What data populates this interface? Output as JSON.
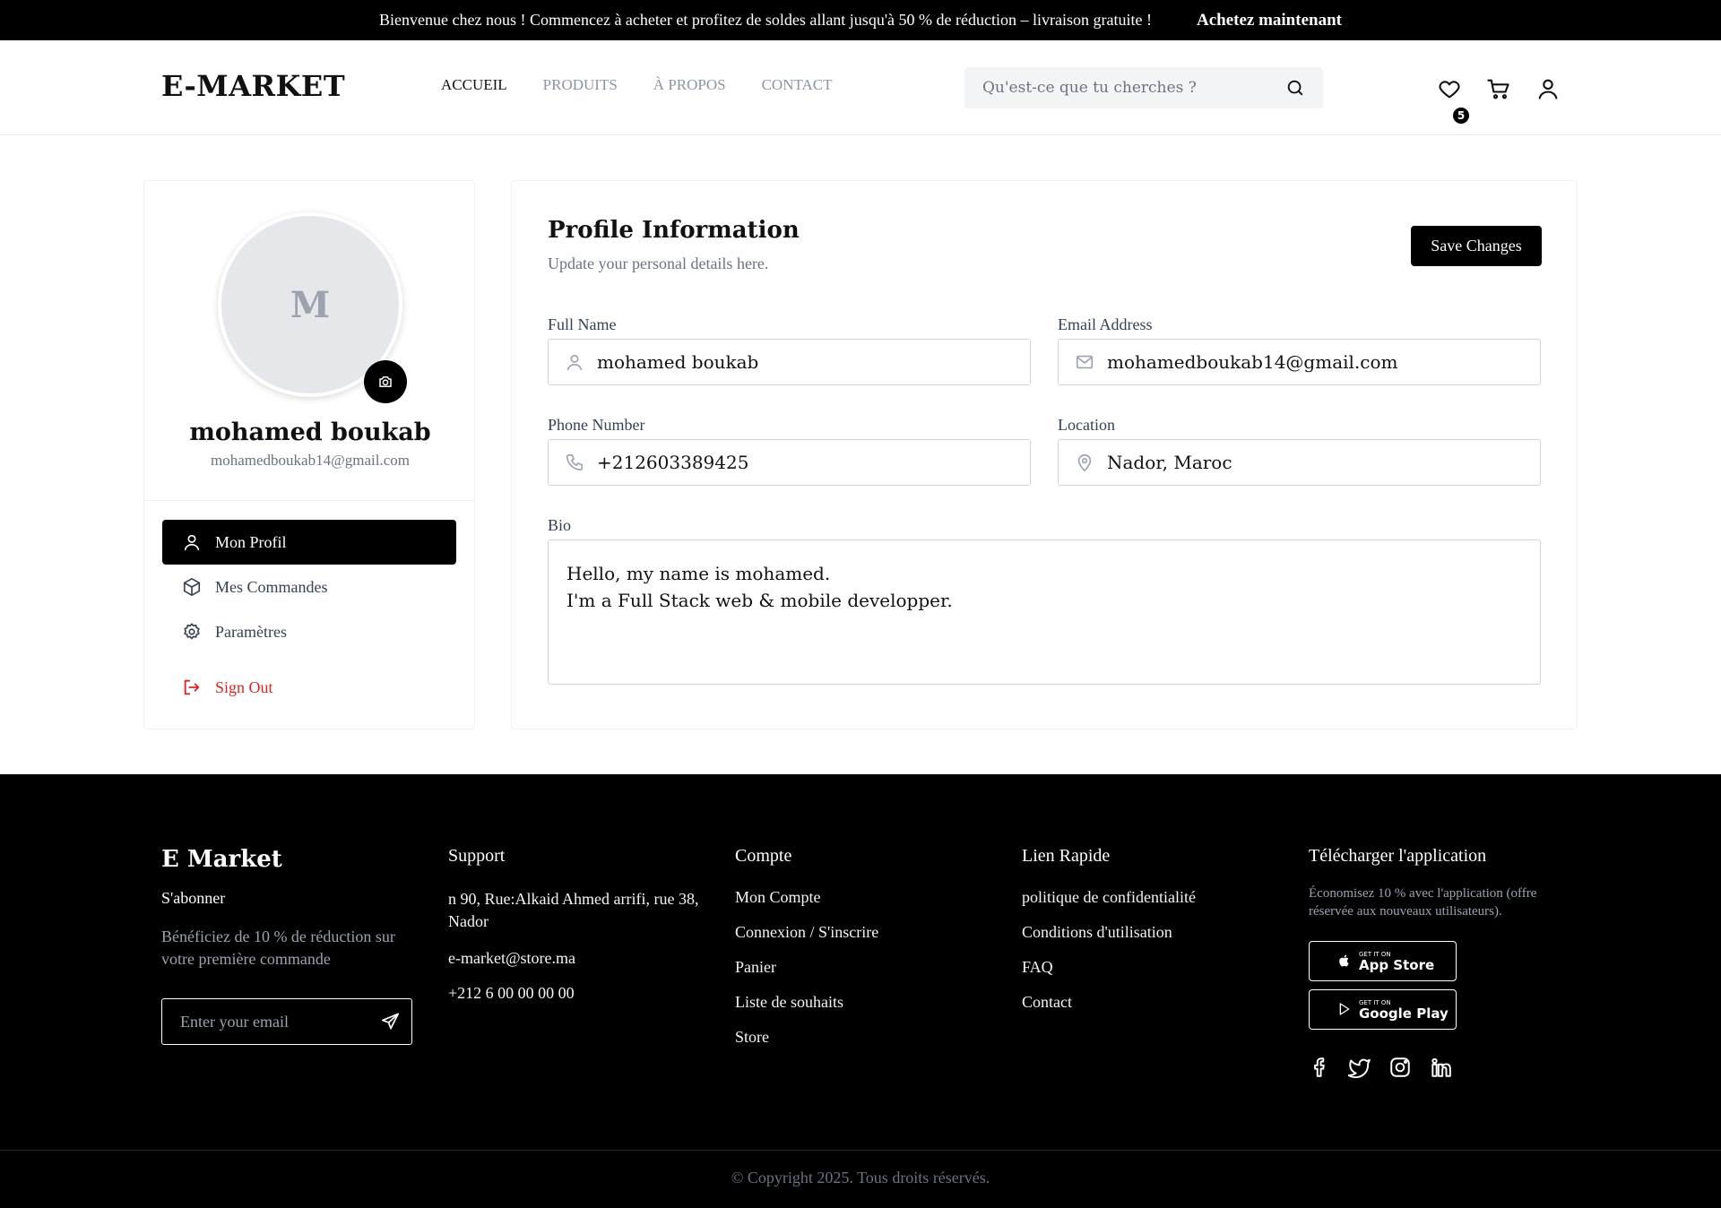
{
  "promo": {
    "text": "Bienvenue chez nous ! Commencez à acheter et profitez de soldes allant jusqu'à 50 % de réduction – livraison gratuite !",
    "cta": "Achetez maintenant"
  },
  "header": {
    "logo": "E-MARKET",
    "nav": [
      "ACCUEIL",
      "PRODUITS",
      "À PROPOS",
      "CONTACT"
    ],
    "search_placeholder": "Qu'est-ce que tu cherches ?",
    "wishlist_count": "5"
  },
  "profile": {
    "avatar_letter": "M",
    "name": "mohamed boukab",
    "email": "mohamedboukab14@gmail.com",
    "menu": {
      "profile": "Mon Profil",
      "orders": "Mes Commandes",
      "settings": "Paramètres",
      "signout": "Sign Out"
    }
  },
  "form": {
    "title": "Profile Information",
    "subtitle": "Update your personal details here.",
    "save_label": "Save Changes",
    "full_name_label": "Full Name",
    "full_name": "mohamed boukab",
    "email_label": "Email Address",
    "email": "mohamedboukab14@gmail.com",
    "phone_label": "Phone Number",
    "phone": "+212603389425",
    "location_label": "Location",
    "location": "Nador, Maroc",
    "bio_label": "Bio",
    "bio_line1": "Hello, my name is mohamed.",
    "bio_line2": "I'm a Full Stack web & mobile developper."
  },
  "footer": {
    "brand": "E Market",
    "subscribe": "S'abonner",
    "subscribe_text": "Bénéficiez de 10 % de réduction sur votre première commande",
    "email_placeholder": "Enter your email",
    "support": {
      "title": "Support",
      "address": "n 90, Rue:Alkaid Ahmed arrifi, rue 38, Nador",
      "email": "e-market@store.ma",
      "phone": "+212 6 00 00 00 00"
    },
    "account": {
      "title": "Compte",
      "links": [
        "Mon Compte",
        "Connexion / S'inscrire",
        "Panier",
        "Liste de souhaits",
        "Store"
      ]
    },
    "quick": {
      "title": "Lien Rapide",
      "links": [
        "politique de confidentialité",
        "Conditions d'utilisation",
        "FAQ",
        "Contact"
      ]
    },
    "app": {
      "title": "Télécharger l'application",
      "text": "Économisez 10 % avec l'application (offre réservée aux nouveaux utilisateurs).",
      "appstore_small": "GET IT ON",
      "appstore": "App Store",
      "googleplay_small": "GET IT ON",
      "googleplay": "Google Play"
    },
    "copyright": "© Copyright 2025. Tous droits réservés."
  },
  "colors": {
    "accent": "#000000",
    "danger": "#dc2626",
    "muted": "#6b7280"
  }
}
